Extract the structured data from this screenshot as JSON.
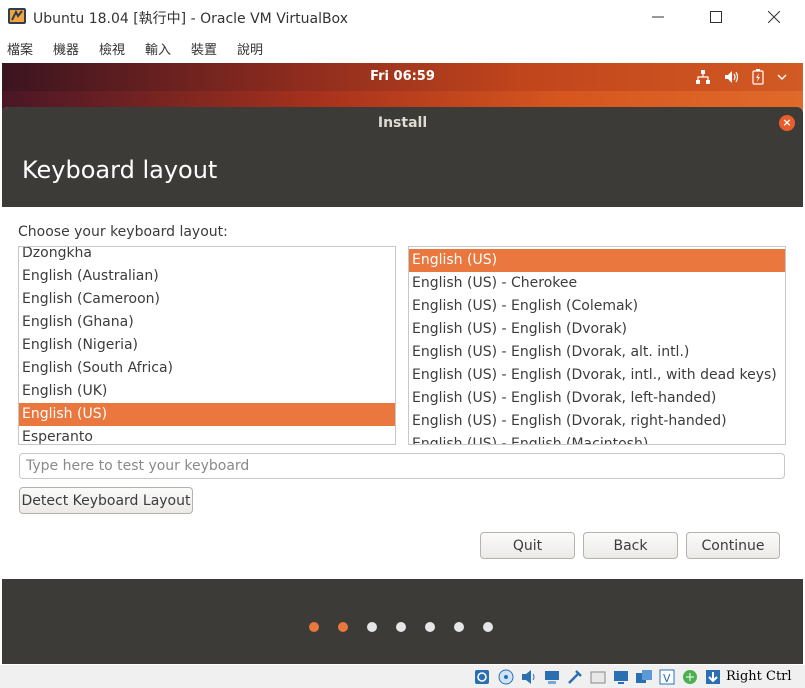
{
  "window": {
    "title": "Ubuntu 18.04 [執行中] - Oracle VM VirtualBox",
    "minimize_icon": "minimize-icon",
    "maximize_icon": "maximize-icon",
    "close_icon": "close-icon"
  },
  "menu": [
    "檔案",
    "機器",
    "檢視",
    "輸入",
    "裝置",
    "說明"
  ],
  "vm_topbar": {
    "clock": "Fri 06:59",
    "tray_icons": [
      "network-icon",
      "volume-icon",
      "battery-icon",
      "power-menu-icon"
    ]
  },
  "installer": {
    "window_title": "Install",
    "page_title": "Keyboard layout",
    "prompt": "Choose your keyboard layout:",
    "layouts": [
      "Dzongkha",
      "English (Australian)",
      "English (Cameroon)",
      "English (Ghana)",
      "English (Nigeria)",
      "English (South Africa)",
      "English (UK)",
      "English (US)",
      "Esperanto"
    ],
    "selected_layout": "English (US)",
    "variants": [
      "English (US)",
      "English (US) - Cherokee",
      "English (US) - English (Colemak)",
      "English (US) - English (Dvorak)",
      "English (US) - English (Dvorak, alt. intl.)",
      "English (US) - English (Dvorak, intl., with dead keys)",
      "English (US) - English (Dvorak, left-handed)",
      "English (US) - English (Dvorak, right-handed)",
      "English (US) - English (Macintosh)"
    ],
    "selected_variant": "English (US)",
    "test_placeholder": "Type here to test your keyboard",
    "detect_button": "Detect Keyboard Layout",
    "quit_button": "Quit",
    "back_button": "Back",
    "continue_button": "Continue",
    "progress": {
      "total_steps": 7,
      "completed_steps": 2
    },
    "colors": {
      "accent": "#e9773e",
      "dot_active": "#e9773e",
      "dot_inactive": "#e6e6e6"
    }
  },
  "statusbar": {
    "host_key": "Right Ctrl",
    "icons": [
      "hard-disk-icon",
      "optical-drive-icon",
      "audio-icon",
      "network-adapter-icon",
      "usb-icon",
      "shared-folder-icon",
      "display-icon",
      "capture-icon",
      "recording-icon",
      "cpu-icon",
      "mouse-integration-icon",
      "keyboard-icon"
    ]
  }
}
